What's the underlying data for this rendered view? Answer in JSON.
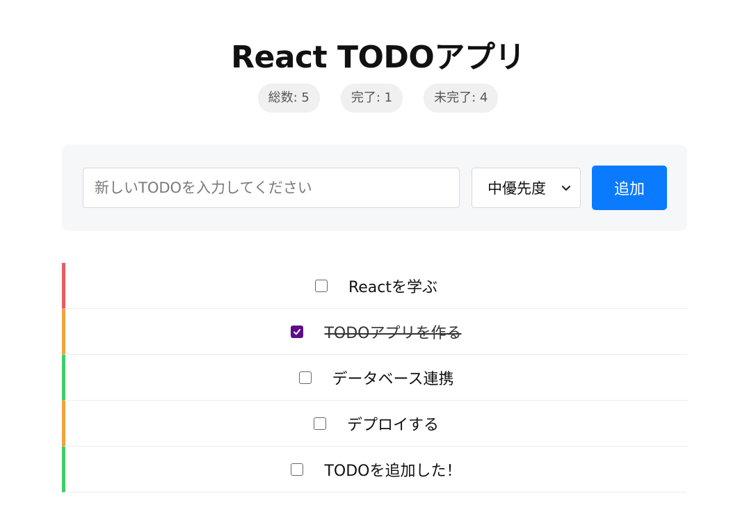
{
  "header": {
    "title": "React TODOアプリ"
  },
  "stats": {
    "total": "総数: 5",
    "completed": "完了: 1",
    "incomplete": "未完了: 4"
  },
  "add_form": {
    "input_placeholder": "新しいTODOを入力してください",
    "input_value": "",
    "priority_selected": "中優先度",
    "add_label": "追加"
  },
  "todos": [
    {
      "text": "Reactを学ぶ",
      "completed": false,
      "priority": "high",
      "priority_color": "#e85a65"
    },
    {
      "text": "TODOアプリを作る",
      "completed": true,
      "priority": "medium",
      "priority_color": "#f2a33a"
    },
    {
      "text": "データベース連携",
      "completed": false,
      "priority": "low",
      "priority_color": "#3fcd6c"
    },
    {
      "text": "デプロイする",
      "completed": false,
      "priority": "medium",
      "priority_color": "#f2a33a"
    },
    {
      "text": "TODOを追加した！",
      "completed": false,
      "priority": "low",
      "priority_color": "#3fcd6c"
    }
  ],
  "colors": {
    "accent": "#0a7bff",
    "checked": "#5c0e8a",
    "priority_high": "#e85a65",
    "priority_medium": "#f2a33a",
    "priority_low": "#3fcd6c"
  },
  "icons": {
    "select": "chevron-down-icon",
    "check": "check-icon"
  }
}
